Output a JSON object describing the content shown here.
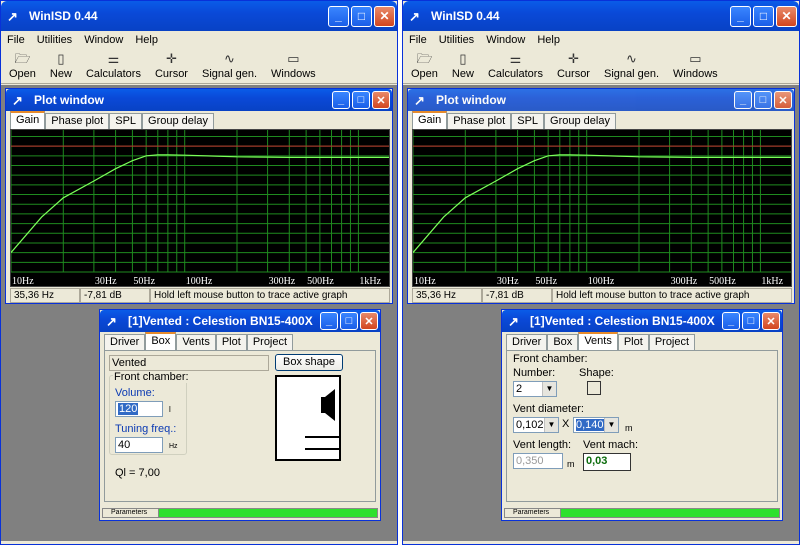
{
  "app": {
    "title": "WinISD 0.44",
    "menu": [
      "File",
      "Utilities",
      "Window",
      "Help"
    ],
    "toolbar": [
      {
        "label": "Open",
        "icon": "folder-open-icon"
      },
      {
        "label": "New",
        "icon": "new-document-icon"
      },
      {
        "label": "Calculators",
        "icon": "calculator-icon"
      },
      {
        "label": "Cursor",
        "icon": "crosshair-icon"
      },
      {
        "label": "Signal gen.",
        "icon": "signal-generator-icon"
      },
      {
        "label": "Windows",
        "icon": "windows-icon"
      }
    ]
  },
  "plot_window": {
    "title": "Plot window",
    "tabs": [
      "Gain",
      "Phase plot",
      "SPL",
      "Group delay"
    ],
    "active_tab": "Gain",
    "x_labels": [
      "10Hz",
      "30Hz",
      "50Hz",
      "100Hz",
      "300Hz",
      "500Hz",
      "1kHz"
    ],
    "status": {
      "freq": "35,36 Hz",
      "gain": "-7,81 dB",
      "hint": "Hold left mouse button to trace active graph"
    }
  },
  "chart_data": {
    "type": "line",
    "xlabel": "",
    "ylabel": "",
    "x_scale": "log",
    "x": [
      10,
      15,
      20,
      30,
      40,
      50,
      60,
      70,
      80,
      100,
      150,
      200,
      300,
      400,
      600,
      1000,
      1500
    ],
    "series": [
      {
        "values": [
          -30,
          -19,
          -13,
          -7.8,
          -4,
          -1.5,
          0,
          0.3,
          0.3,
          0.2,
          -0.1,
          -0.3,
          -0.4,
          -0.5,
          -0.5,
          -0.5,
          -0.5
        ]
      }
    ],
    "colors": {
      "curve": "#7cff5a",
      "grid": "#1f8a1f",
      "reference": "#c23030",
      "background": "#000000"
    }
  },
  "left_dialog": {
    "title": "[1]Vented : Celestion BN15-400X",
    "tabs": [
      "Driver",
      "Box",
      "Vents",
      "Plot",
      "Project"
    ],
    "active_tab": "Box",
    "box_type": "Vented",
    "box_shape_button": "Box shape",
    "front_chamber_label": "Front chamber:",
    "volume_label": "Volume:",
    "volume_value": "120",
    "volume_unit": "l",
    "tuning_label": "Tuning freq.:",
    "tuning_value": "40",
    "tuning_unit": "Hz",
    "ql_text": "Ql = 7,00",
    "progress_label": "Parameters"
  },
  "right_dialog": {
    "title": "[1]Vented : Celestion BN15-400X",
    "tabs": [
      "Driver",
      "Box",
      "Vents",
      "Plot",
      "Project"
    ],
    "active_tab": "Vents",
    "front_chamber_label": "Front chamber:",
    "number_label": "Number:",
    "number_value": "2",
    "shape_label": "Shape:",
    "vent_diameter_label": "Vent diameter:",
    "diameter_1": "0,102",
    "times": "X",
    "diameter_2": "0,140",
    "diameter_unit": "m",
    "vent_length_label": "Vent length:",
    "vent_length_value": "0,350",
    "vent_length_unit": "m",
    "vent_mach_label": "Vent mach:",
    "vent_mach_value": "0,03",
    "progress_label": "Parameters"
  }
}
